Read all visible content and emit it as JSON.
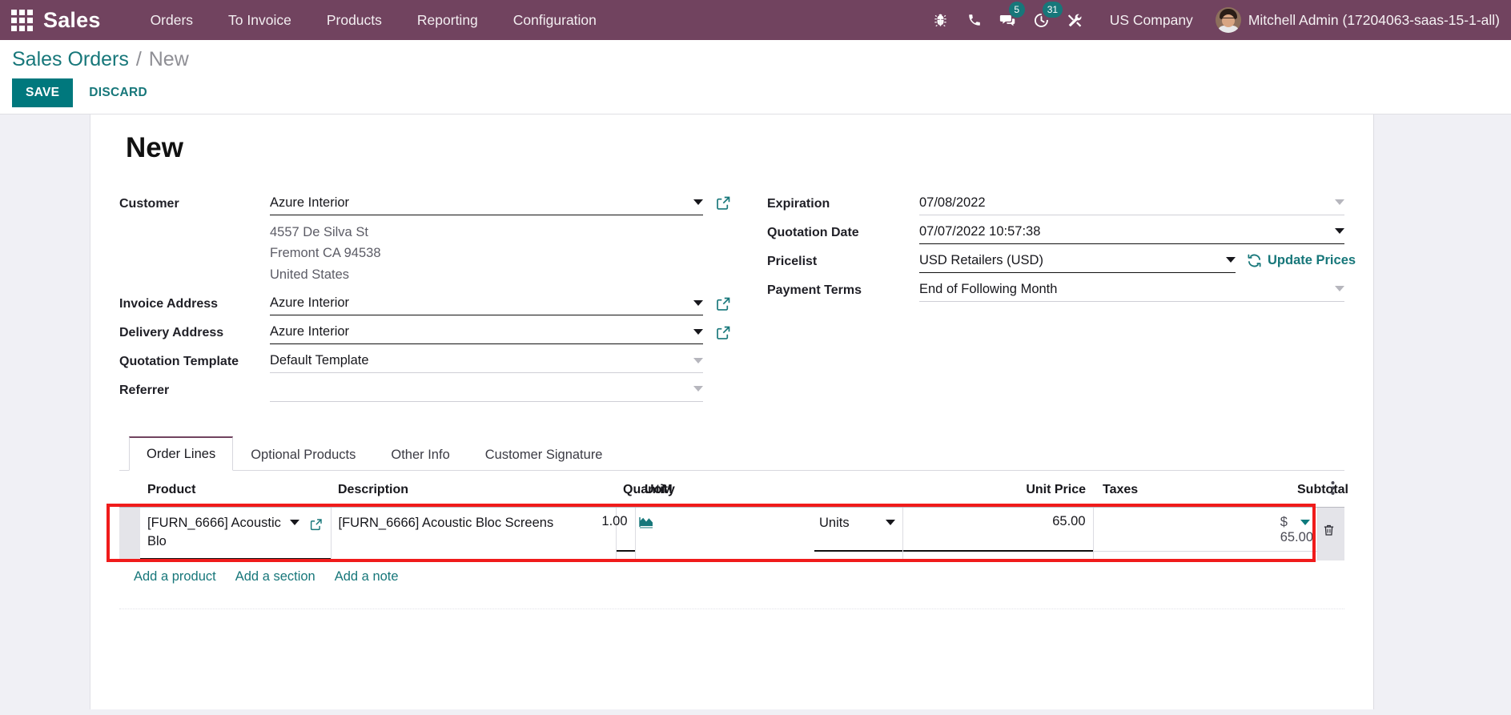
{
  "navbar": {
    "apps_icon": "apps-grid-icon",
    "brand": "Sales",
    "menu": [
      {
        "label": "Orders"
      },
      {
        "label": "To Invoice"
      },
      {
        "label": "Products"
      },
      {
        "label": "Reporting"
      },
      {
        "label": "Configuration"
      }
    ],
    "sys_icons": [
      {
        "name": "bug-icon",
        "badge": ""
      },
      {
        "name": "phone-icon",
        "badge": ""
      },
      {
        "name": "messages-icon",
        "badge": "5"
      },
      {
        "name": "activities-clock-icon",
        "badge": "31"
      },
      {
        "name": "tools-icon",
        "badge": ""
      }
    ],
    "company": "US Company",
    "user": "Mitchell Admin (17204063-saas-15-1-all)",
    "accent_color": "#71435f",
    "badge_color": "#17777a"
  },
  "control_panel": {
    "breadcrumb_root": "Sales Orders",
    "breadcrumb_sep": "/",
    "breadcrumb_current": "New",
    "save_label": "SAVE",
    "discard_label": "DISCARD",
    "save_bg": "#00787d"
  },
  "form": {
    "record_title": "New",
    "left_fields": [
      {
        "label": "Customer",
        "value": "Azure Interior",
        "has_caret": true,
        "caret_style": "dark",
        "has_external": true,
        "underline": "dark"
      },
      {
        "label": "Invoice Address",
        "value": "Azure Interior",
        "has_caret": true,
        "caret_style": "dark",
        "has_external": true,
        "underline": "dark"
      },
      {
        "label": "Delivery Address",
        "value": "Azure Interior",
        "has_caret": true,
        "caret_style": "dark",
        "has_external": true,
        "underline": "dark"
      },
      {
        "label": "Quotation Template",
        "value": "Default Template",
        "has_caret": true,
        "caret_style": "grey",
        "has_external": false,
        "underline": "light"
      },
      {
        "label": "Referrer",
        "value": "",
        "has_caret": true,
        "caret_style": "grey",
        "has_external": false,
        "underline": "light"
      }
    ],
    "customer_address": [
      "4557 De Silva St",
      "Fremont CA 94538",
      "United States"
    ],
    "right_fields": [
      {
        "label": "Expiration",
        "value": "07/08/2022",
        "has_caret": true,
        "caret_style": "grey",
        "underline": "light",
        "extra": ""
      },
      {
        "label": "Quotation Date",
        "value": "07/07/2022 10:57:38",
        "has_caret": true,
        "caret_style": "dark",
        "underline": "dark",
        "extra": ""
      },
      {
        "label": "Pricelist",
        "value": "USD Retailers (USD)",
        "has_caret": true,
        "caret_style": "dark",
        "underline": "dark",
        "extra": "Update Prices"
      },
      {
        "label": "Payment Terms",
        "value": "End of Following Month",
        "has_caret": true,
        "caret_style": "grey",
        "underline": "light",
        "extra": ""
      }
    ],
    "update_prices_label": "Update Prices",
    "update_prices_icon": "refresh-icon"
  },
  "notebook": {
    "tabs": [
      {
        "label": "Order Lines",
        "active": true
      },
      {
        "label": "Optional Products",
        "active": false
      },
      {
        "label": "Other Info",
        "active": false
      },
      {
        "label": "Customer Signature",
        "active": false
      }
    ]
  },
  "order_lines": {
    "columns": [
      {
        "label": "Product",
        "align": "left"
      },
      {
        "label": "Description",
        "align": "left"
      },
      {
        "label": "Quantity",
        "align": "right"
      },
      {
        "label": "UoM",
        "align": "left"
      },
      {
        "label": "Unit Price",
        "align": "right"
      },
      {
        "label": "Taxes",
        "align": "left"
      },
      {
        "label": "Subtotal",
        "align": "right"
      }
    ],
    "optional_columns_icon": "vertical-dots-icon",
    "rows": [
      {
        "product": "[FURN_6666] Acoustic Blo",
        "product_caret": "chevron-down-icon",
        "product_external": "external-link-icon",
        "description": "[FURN_6666] Acoustic Bloc Screens",
        "quantity": "1.00",
        "uom_icon": "forecast-chart-icon",
        "uom": "Units",
        "unit_price": "65.00",
        "taxes": "",
        "subtotal": "$ 65.00",
        "delete_icon": "trash-icon"
      }
    ],
    "footer_links": [
      {
        "label": "Add a product"
      },
      {
        "label": "Add a section"
      },
      {
        "label": "Add a note"
      }
    ],
    "highlight_color": "#f01b1b"
  }
}
